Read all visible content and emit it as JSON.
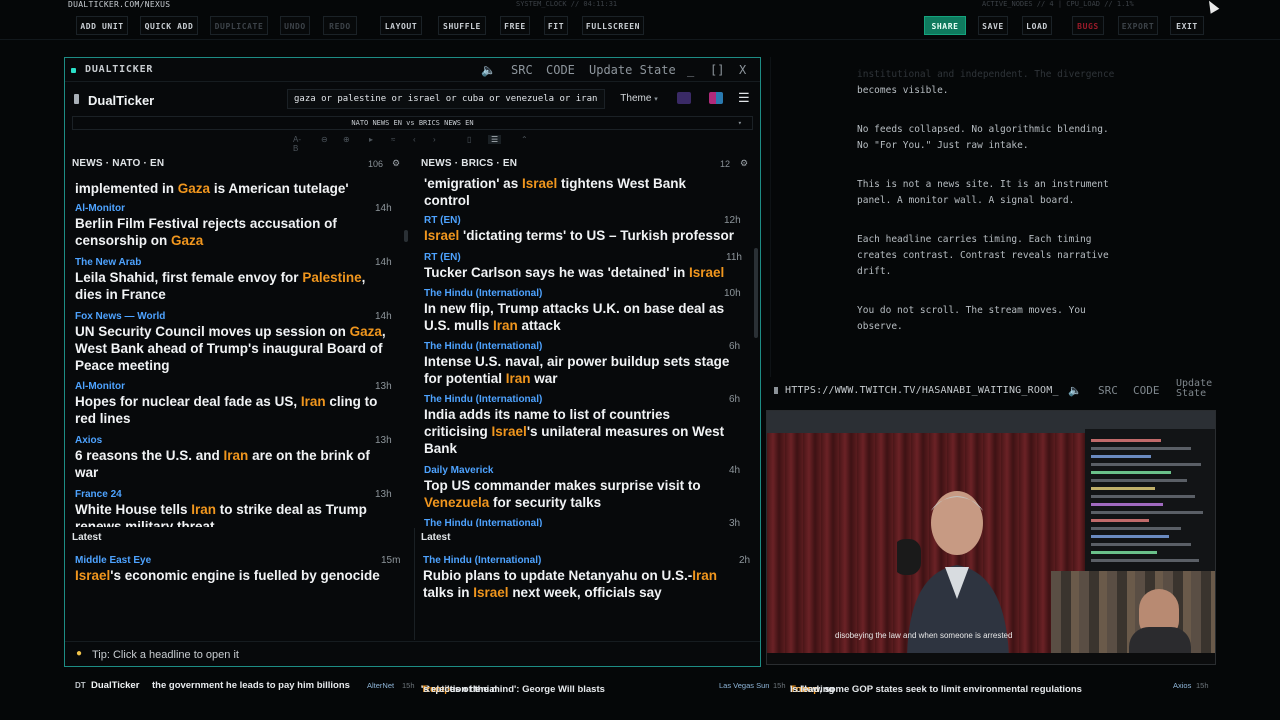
{
  "sysbar": {
    "brand": "DUALTICKER.COM/NEXUS",
    "clock": "SYSTEM_CLOCK // 04:11:31",
    "nodes": "ACTIVE_NODES // 4 | CPU_LOAD // 1.1%"
  },
  "toolbar": {
    "add_unit": "ADD UNIT",
    "quick_add": "QUICK ADD",
    "duplicate": "DUPLICATE",
    "undo": "UNDO",
    "redo": "REDO",
    "layout": "LAYOUT",
    "shuffle": "SHUFFLE",
    "free": "FREE",
    "fit": "FIT",
    "fullscreen": "FULLSCREEN",
    "share": "SHARE",
    "save": "SAVE",
    "load": "LOAD",
    "bugs": "BUGS",
    "export": "EXPORT",
    "exit": "EXIT"
  },
  "window": {
    "title": "DUALTICKER",
    "src": "SRC",
    "code": "CODE",
    "update_state": "Update State",
    "minimize": "_",
    "maximize": "[]",
    "close": "X"
  },
  "app": {
    "name": "DualTicker",
    "search_value": "gaza or palestine or israel or cuba or venezuela or iran",
    "theme_label": "Theme",
    "feed_selector": "NATO NEWS EN vs BRICS NEWS EN",
    "iconrow": [
      "A-B",
      "⊖",
      "⊕",
      "▸",
      "≈",
      "‹",
      "›",
      "▯",
      "☰",
      "⌃"
    ]
  },
  "left": {
    "heading": "NEWS · NATO · EN",
    "count": "106",
    "partial_headline": "implemented in ",
    "partial_kw": "Gaza",
    "partial_tail": " is American tutelage'",
    "items": [
      {
        "source": "Al-Monitor",
        "time": "14h",
        "l1a": "Berlin Film Festival rejects accusation of",
        "l1k": "",
        "l1b": "",
        "l2a": "censorship on ",
        "l2k": "Gaza",
        "l2b": "",
        "l3a": "",
        "l3k": "",
        "l3b": ""
      },
      {
        "source": "The New Arab",
        "time": "14h",
        "l1a": "Leila Shahid, first female envoy for ",
        "l1k": "Palestine",
        "l1b": ",",
        "l2a": "dies in France",
        "l2k": "",
        "l2b": "",
        "l3a": "",
        "l3k": "",
        "l3b": ""
      },
      {
        "source": "Fox News — World",
        "time": "14h",
        "l1a": "UN Security Council moves up session on ",
        "l1k": "Gaza",
        "l1b": ",",
        "l2a": "West Bank ahead of Trump's inaugural Board of",
        "l2k": "",
        "l2b": "",
        "l3a": "Peace meeting",
        "l3k": "",
        "l3b": ""
      },
      {
        "source": "Al-Monitor",
        "time": "13h",
        "l1a": "Hopes for nuclear deal fade as US, ",
        "l1k": "Iran",
        "l1b": " cling to",
        "l2a": "red lines",
        "l2k": "",
        "l2b": "",
        "l3a": "",
        "l3k": "",
        "l3b": ""
      },
      {
        "source": "Axios",
        "time": "13h",
        "l1a": "6 reasons the U.S. and ",
        "l1k": "Iran",
        "l1b": " are on the brink of",
        "l2a": "war",
        "l2k": "",
        "l2b": "",
        "l3a": "",
        "l3k": "",
        "l3b": ""
      },
      {
        "source": "France 24",
        "time": "13h",
        "l1a": "White House tells ",
        "l1k": "Iran",
        "l1b": " to strike deal as Trump",
        "l2a": "renews military threat",
        "l2k": "",
        "l2b": "",
        "l3a": "",
        "l3k": "",
        "l3b": ""
      }
    ],
    "latest_label": "Latest",
    "latest": {
      "source": "Middle East Eye",
      "time": "15m",
      "l1k": "Israel",
      "l1b": "'s economic engine is fuelled by genocide"
    }
  },
  "right": {
    "heading": "NEWS · BRICS · EN",
    "count": "12",
    "partial_a": "'emigration' as ",
    "partial_kw": "Israel",
    "partial_b": " tightens West Bank",
    "partial_l2": "control",
    "items": [
      {
        "source": "RT (EN)",
        "time": "12h",
        "l1a": "",
        "l1k": "Israel",
        "l1b": " 'dictating terms' to US – Turkish professor",
        "l2a": "",
        "l2k": "",
        "l2b": "",
        "l3a": "",
        "l3k": "",
        "l3b": ""
      },
      {
        "source": "RT (EN)",
        "time": "11h",
        "l1a": "Tucker Carlson says he was 'detained' in ",
        "l1k": "Israel",
        "l1b": "",
        "l2a": "",
        "l2k": "",
        "l2b": "",
        "l3a": "",
        "l3k": "",
        "l3b": ""
      },
      {
        "source": "The Hindu (International)",
        "time": "10h",
        "l1a": "In new flip, Trump attacks U.K. on base deal as",
        "l1k": "",
        "l1b": "",
        "l2a": "U.S. mulls ",
        "l2k": "Iran",
        "l2b": " attack",
        "l3a": "",
        "l3k": "",
        "l3b": ""
      },
      {
        "source": "The Hindu (International)",
        "time": "6h",
        "l1a": "Intense U.S. naval, air power buildup sets stage",
        "l1k": "",
        "l1b": "",
        "l2a": "for potential ",
        "l2k": "Iran",
        "l2b": " war",
        "l3a": "",
        "l3k": "",
        "l3b": ""
      },
      {
        "source": "The Hindu (International)",
        "time": "6h",
        "l1a": "India adds its name to list of countries",
        "l1k": "",
        "l1b": "",
        "l2a": "criticising ",
        "l2k": "Israel",
        "l2b": "'s unilateral measures on West",
        "l3a": "Bank",
        "l3k": "",
        "l3b": ""
      },
      {
        "source": "Daily Maverick",
        "time": "4h",
        "l1a": "Top US commander makes surprise visit to",
        "l1k": "",
        "l1b": "",
        "l2a": "",
        "l2k": "Venezuela",
        "l2b": " for security talks",
        "l3a": "",
        "l3k": "",
        "l3b": ""
      },
      {
        "source": "The Hindu (International)",
        "time": "3h",
        "l1a": "",
        "l1k": "",
        "l1b": "",
        "l2a": "",
        "l2k": "",
        "l2b": "",
        "l3a": "",
        "l3k": "",
        "l3b": ""
      }
    ],
    "latest_label": "Latest",
    "latest": {
      "source": "The Hindu (International)",
      "time": "2h",
      "l1a": "Rubio plans to update Netanyahu on U.S.-",
      "l1k": "Iran",
      "l2a": "talks in ",
      "l2k": "Israel",
      "l2b": " next week, officials say"
    }
  },
  "tip": "Tip: Click a headline to open it",
  "manifesto": {
    "faded1": "institutional and independent. The divergence",
    "line1": "becomes visible.",
    "p2a": "No feeds collapsed. No algorithmic blending.",
    "p2b": "No \"For You.\" Just raw intake.",
    "p3a": "This is not a news site. It is an instrument",
    "p3b": "panel. A monitor wall. A signal board.",
    "p4a": "Each headline carries timing. Each timing",
    "p4b": "creates contrast. Contrast reveals narrative",
    "p4c": "drift.",
    "p5a": "You do not scroll. The stream moves. You",
    "p5b": "observe."
  },
  "twitch": {
    "url": "HTTPS://WWW.TWITCH.TV/HASANABI_WAITING_ROOM_",
    "src": "SRC",
    "code": "CODE",
    "update1": "Update",
    "update2": "State",
    "caption": "disobeying the law and when someone is arrested"
  },
  "ticker": {
    "tag": "DT",
    "name": "DualTicker",
    "t1": "the government he leads to pay him billions",
    "s2": "AlterNet",
    "h2": "15h",
    "t2a": "'Reptiles of the mind': George Will blasts ",
    "t2k": "Trump",
    "t2b": "'s election denial",
    "s3": "Las Vegas Sun",
    "h3": "15h",
    "t3a": "Following ",
    "t3k": "Trump",
    "t3b": "'s lead, some GOP states seek to limit environmental regulations",
    "s4": "Axios",
    "h4": "15h"
  },
  "colors": {
    "accent": "#1d8c84",
    "keyword": "#f0961e",
    "source": "#4ea3ff",
    "share": "#0f7a5e"
  }
}
